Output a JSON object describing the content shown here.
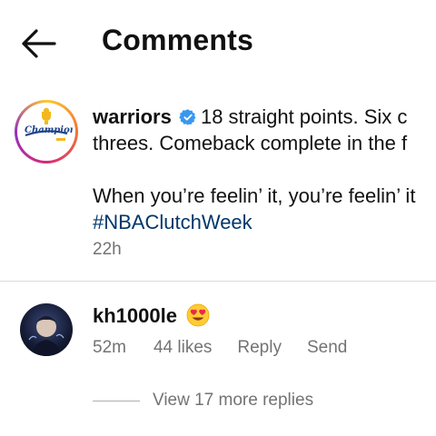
{
  "header": {
    "title": "Comments"
  },
  "post": {
    "username": "warriors",
    "caption_line1": "18 straight points. Six c",
    "caption_line2": "threes. Comeback complete in the f",
    "caption_line3": "When you’re feelin’ it, you’re feelin’ it",
    "hashtag": "#NBAClutchWeek",
    "time": "22h",
    "logo_text": "Champions"
  },
  "comment": {
    "username": "kh1000le",
    "emoji": "heart-eyes-emoji",
    "time": "52m",
    "likes": "44 likes",
    "reply_label": "Reply",
    "send_label": "Send",
    "view_more": "View 17 more replies"
  },
  "colors": {
    "hashtag": "#00376b",
    "verified": "#3897f0",
    "meta": "#737373"
  }
}
